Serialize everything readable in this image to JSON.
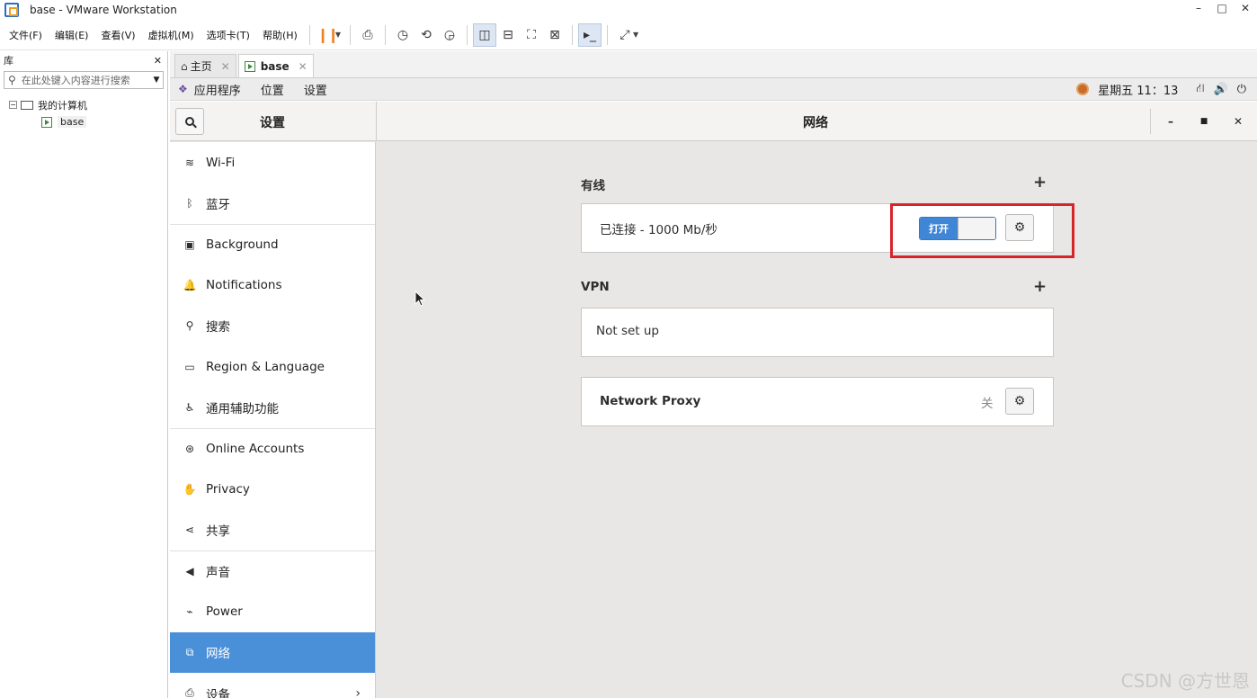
{
  "window": {
    "title": "base - VMware Workstation",
    "min": "–",
    "max": "□",
    "close": "✕"
  },
  "menu": [
    "文件(F)",
    "编辑(E)",
    "查看(V)",
    "虚拟机(M)",
    "选项卡(T)",
    "帮助(H)"
  ],
  "library": {
    "title": "库",
    "close": "✕",
    "search_placeholder": "在此处键入内容进行搜索",
    "tree": {
      "root": "我的计算机",
      "child": "base"
    }
  },
  "tabs": [
    {
      "label": "主页",
      "close": "✕"
    },
    {
      "label": "base",
      "close": "✕"
    }
  ],
  "gnome": {
    "menus": [
      "应用程序",
      "位置",
      "设置"
    ],
    "clock": "星期五 11：13"
  },
  "settings": {
    "left_title": "设置",
    "main_title": "网络",
    "sidebar": [
      {
        "label": "Wi-Fi",
        "icon": "wifi-icon",
        "glyph": "≋"
      },
      {
        "label": "蓝牙",
        "icon": "bluetooth-icon",
        "glyph": "ᛒ"
      },
      {
        "label": "Background",
        "icon": "background-icon",
        "glyph": "▣"
      },
      {
        "label": "Notifications",
        "icon": "bell-icon",
        "glyph": "🔔"
      },
      {
        "label": "搜索",
        "icon": "search-icon",
        "glyph": "⚲"
      },
      {
        "label": "Region & Language",
        "icon": "region-icon",
        "glyph": "▭"
      },
      {
        "label": "通用辅助功能",
        "icon": "accessibility-icon",
        "glyph": "♿"
      },
      {
        "label": "Online Accounts",
        "icon": "online-accounts-icon",
        "glyph": "⊛"
      },
      {
        "label": "Privacy",
        "icon": "hand-icon",
        "glyph": "✋"
      },
      {
        "label": "共享",
        "icon": "share-icon",
        "glyph": "⋖"
      },
      {
        "label": "声音",
        "icon": "speaker-icon",
        "glyph": "◀"
      },
      {
        "label": "Power",
        "icon": "power-icon",
        "glyph": "⌁"
      },
      {
        "label": "网络",
        "icon": "network-icon",
        "glyph": "⧉"
      },
      {
        "label": "设备",
        "icon": "devices-icon",
        "glyph": "⎙"
      }
    ],
    "chevron": "›",
    "wired": {
      "label": "有线",
      "add": "+",
      "status": "已连接 - 1000 Mb/秒",
      "switch_label": "打开"
    },
    "vpn": {
      "label": "VPN",
      "add": "+",
      "status": "Not set up"
    },
    "proxy": {
      "label": "Network Proxy",
      "state": "关"
    }
  },
  "watermark": "CSDN @方世恩",
  "colors": {
    "accent": "#4a90d9",
    "switch_on": "#3f86d6",
    "highlight": "#d9232a"
  }
}
